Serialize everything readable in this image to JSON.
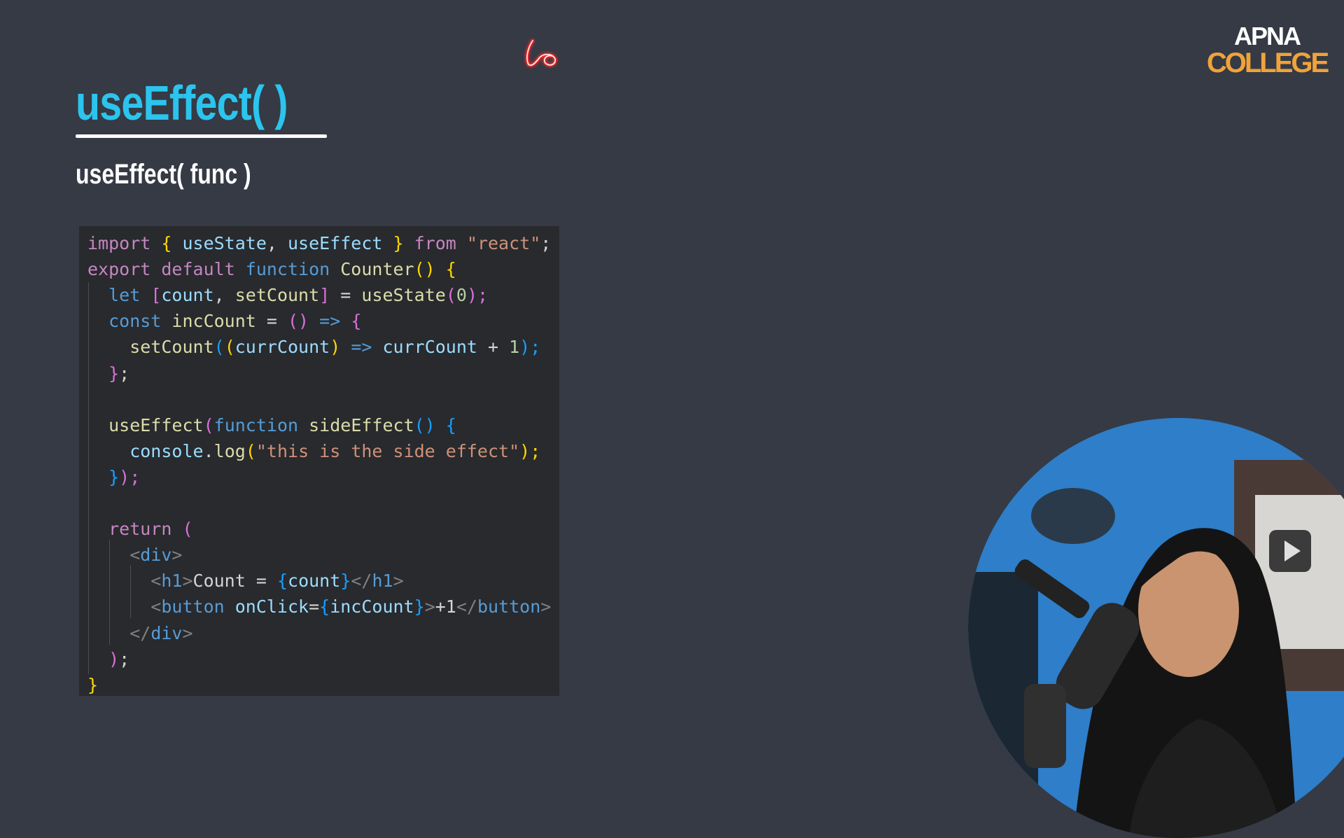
{
  "slide": {
    "title": "useEffect( )",
    "subtitle": "useEffect( func )",
    "logo_line1": "APNA",
    "logo_line2": "COLLEGE"
  },
  "colors": {
    "background": "#353a44",
    "title": "#2bc4ee",
    "code_bg": "#282a2e",
    "logo_orange": "#f0a33a"
  },
  "code": {
    "lines": [
      [
        [
          "import ",
          "#c586c0"
        ],
        [
          "{ ",
          "#ffd700"
        ],
        [
          "useState",
          "#9cdcfe"
        ],
        [
          ", ",
          "#d4d4d4"
        ],
        [
          "useEffect",
          "#9cdcfe"
        ],
        [
          " } ",
          "#ffd700"
        ],
        [
          "from ",
          "#c586c0"
        ],
        [
          "\"react\"",
          "#ce9178"
        ],
        [
          ";",
          "#d4d4d4"
        ]
      ],
      [
        [
          "export ",
          "#c586c0"
        ],
        [
          "default ",
          "#c586c0"
        ],
        [
          "function ",
          "#569cd6"
        ],
        [
          "Counter",
          "#dcdcaa"
        ],
        [
          "() {",
          "#ffd700"
        ]
      ],
      [
        [
          "  let ",
          "#569cd6"
        ],
        [
          "[",
          "#da70d6"
        ],
        [
          "count",
          "#9cdcfe"
        ],
        [
          ", ",
          "#d4d4d4"
        ],
        [
          "setCount",
          "#dcdcaa"
        ],
        [
          "] ",
          "#da70d6"
        ],
        [
          "= ",
          "#d4d4d4"
        ],
        [
          "useState",
          "#dcdcaa"
        ],
        [
          "(",
          "#da70d6"
        ],
        [
          "0",
          "#b5cea8"
        ],
        [
          ");",
          "#da70d6"
        ]
      ],
      [
        [
          "  const ",
          "#569cd6"
        ],
        [
          "incCount ",
          "#dcdcaa"
        ],
        [
          "= ",
          "#d4d4d4"
        ],
        [
          "() ",
          "#da70d6"
        ],
        [
          "=> ",
          "#569cd6"
        ],
        [
          "{",
          "#da70d6"
        ]
      ],
      [
        [
          "    setCount",
          "#dcdcaa"
        ],
        [
          "(",
          "#179fff"
        ],
        [
          "(",
          "#ffd700"
        ],
        [
          "currCount",
          "#9cdcfe"
        ],
        [
          ") ",
          "#ffd700"
        ],
        [
          "=> ",
          "#569cd6"
        ],
        [
          "currCount ",
          "#9cdcfe"
        ],
        [
          "+ ",
          "#d4d4d4"
        ],
        [
          "1",
          "#b5cea8"
        ],
        [
          ");",
          "#179fff"
        ]
      ],
      [
        [
          "  }",
          "#da70d6"
        ],
        [
          ";",
          "#d4d4d4"
        ]
      ],
      [
        [
          "",
          ""
        ]
      ],
      [
        [
          "  useEffect",
          "#dcdcaa"
        ],
        [
          "(",
          "#da70d6"
        ],
        [
          "function ",
          "#569cd6"
        ],
        [
          "sideEffect",
          "#dcdcaa"
        ],
        [
          "() ",
          "#179fff"
        ],
        [
          "{",
          "#179fff"
        ]
      ],
      [
        [
          "    console",
          "#9cdcfe"
        ],
        [
          ".",
          "#d4d4d4"
        ],
        [
          "log",
          "#dcdcaa"
        ],
        [
          "(",
          "#ffd700"
        ],
        [
          "\"this is the side effect\"",
          "#ce9178"
        ],
        [
          ");",
          "#ffd700"
        ]
      ],
      [
        [
          "  }",
          "#179fff"
        ],
        [
          ");",
          "#da70d6"
        ]
      ],
      [
        [
          "",
          ""
        ]
      ],
      [
        [
          "  return ",
          "#c586c0"
        ],
        [
          "(",
          "#da70d6"
        ]
      ],
      [
        [
          "    <",
          "#808080"
        ],
        [
          "div",
          "#569cd6"
        ],
        [
          ">",
          "#808080"
        ]
      ],
      [
        [
          "      <",
          "#808080"
        ],
        [
          "h1",
          "#569cd6"
        ],
        [
          ">",
          "#808080"
        ],
        [
          "Count = ",
          "#d4d4d4"
        ],
        [
          "{",
          "#179fff"
        ],
        [
          "count",
          "#9cdcfe"
        ],
        [
          "}",
          "#179fff"
        ],
        [
          "</",
          "#808080"
        ],
        [
          "h1",
          "#569cd6"
        ],
        [
          ">",
          "#808080"
        ]
      ],
      [
        [
          "      <",
          "#808080"
        ],
        [
          "button ",
          "#569cd6"
        ],
        [
          "onClick",
          "#9cdcfe"
        ],
        [
          "=",
          "#d4d4d4"
        ],
        [
          "{",
          "#179fff"
        ],
        [
          "incCount",
          "#9cdcfe"
        ],
        [
          "}",
          "#179fff"
        ],
        [
          ">",
          "#808080"
        ],
        [
          "+1",
          "#d4d4d4"
        ],
        [
          "</",
          "#808080"
        ],
        [
          "button",
          "#569cd6"
        ],
        [
          ">",
          "#808080"
        ]
      ],
      [
        [
          "    </",
          "#808080"
        ],
        [
          "div",
          "#569cd6"
        ],
        [
          ">",
          "#808080"
        ]
      ],
      [
        [
          "  )",
          "#da70d6"
        ],
        [
          ";",
          "#d4d4d4"
        ]
      ],
      [
        [
          "}",
          "#ffd700"
        ]
      ]
    ]
  }
}
